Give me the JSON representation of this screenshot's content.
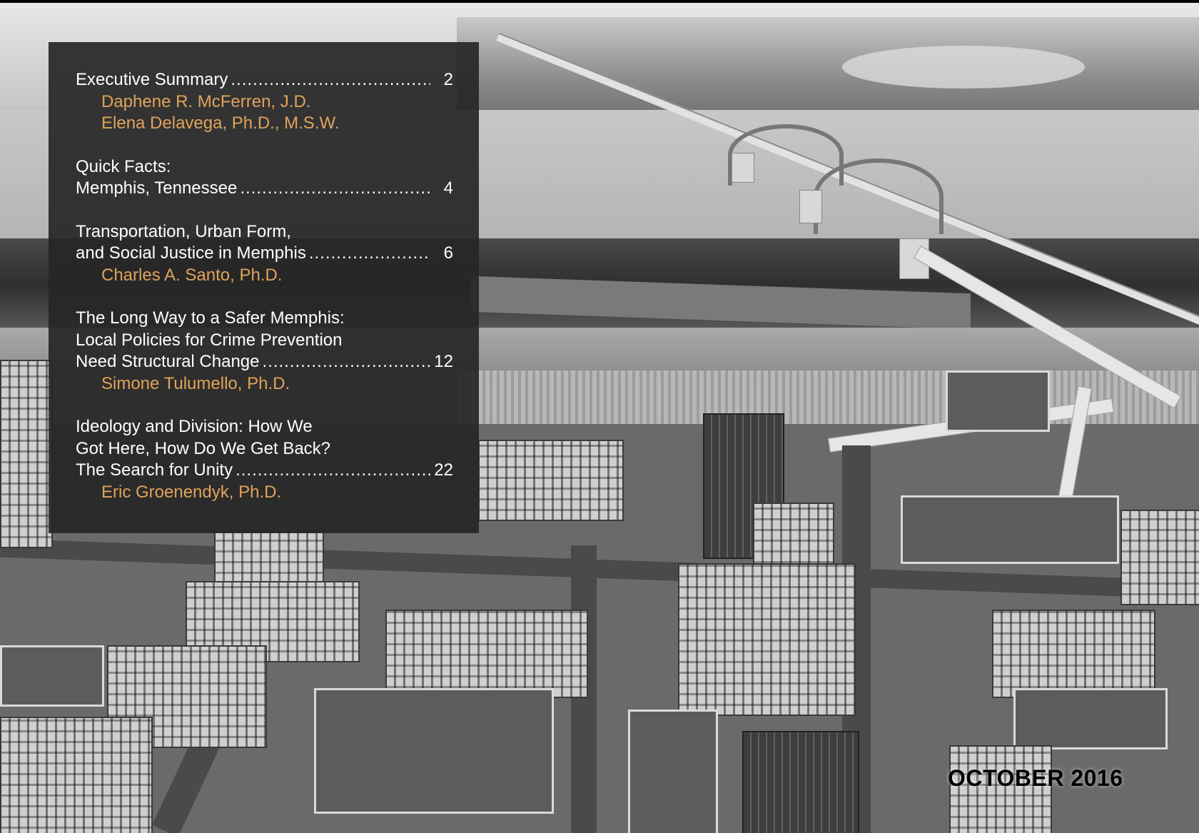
{
  "toc": {
    "entries": [
      {
        "lines": [
          {
            "text": "Executive Summary ",
            "page": "2"
          }
        ],
        "authors": [
          "Daphene R. McFerren, J.D.",
          "Elena Delavega, Ph.D., M.S.W."
        ]
      },
      {
        "lines": [
          {
            "text": "Quick Facts:",
            "page": ""
          },
          {
            "text": "Memphis, Tennessee ",
            "page": "4"
          }
        ],
        "authors": []
      },
      {
        "lines": [
          {
            "text": "Transportation, Urban Form,",
            "page": ""
          },
          {
            "text": "and Social Justice in Memphis ",
            "page": "6"
          }
        ],
        "authors": [
          "Charles A. Santo, Ph.D."
        ]
      },
      {
        "lines": [
          {
            "text": "The Long Way to a Safer Memphis:",
            "page": ""
          },
          {
            "text": "Local Policies for Crime Prevention",
            "page": ""
          },
          {
            "text": "Need Structural Change",
            "page": "12"
          }
        ],
        "authors": [
          "Simone Tulumello, Ph.D."
        ]
      },
      {
        "lines": [
          {
            "text": "Ideology and Division: How We",
            "page": ""
          },
          {
            "text": "Got Here, How Do We Get Back?",
            "page": ""
          },
          {
            "text": "The Search for Unity",
            "page": "22"
          }
        ],
        "authors": [
          "Eric Groenendyk, Ph.D."
        ]
      }
    ]
  },
  "issue_date": "OCTOBER 2016",
  "colors": {
    "toc_background": "#262626",
    "toc_text": "#ffffff",
    "author_text": "#e0a35a",
    "date_text": "#000000"
  }
}
